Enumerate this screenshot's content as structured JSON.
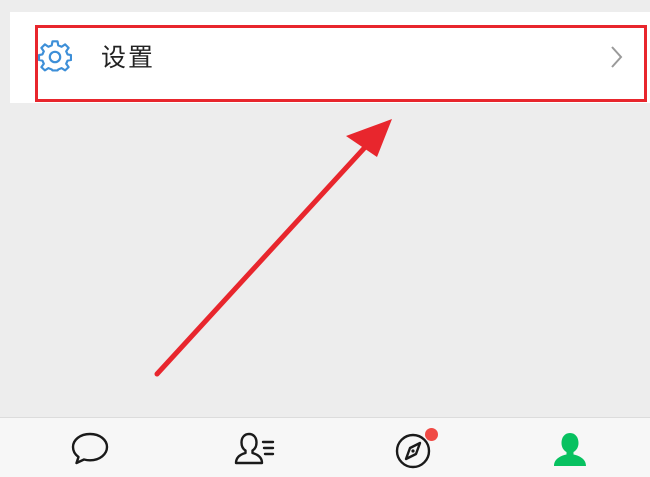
{
  "settings_row": {
    "label": "设置",
    "icon": "gear-icon",
    "chevron": "chevron-right-icon"
  },
  "annotation": {
    "highlight_color": "#e8262d",
    "arrow_color": "#e8262d"
  },
  "tabbar": {
    "tabs": [
      {
        "icon": "chat-bubble-icon",
        "selected": false
      },
      {
        "icon": "contacts-icon",
        "selected": false
      },
      {
        "icon": "compass-icon",
        "selected": false,
        "badge": "red-dot"
      },
      {
        "icon": "person-icon",
        "selected": true
      }
    ],
    "selected_color": "#07c160",
    "icon_color": "#1a1a1a"
  },
  "colors": {
    "background": "#ededed",
    "row_background": "#ffffff",
    "gear_icon": "#3d8fd8"
  }
}
